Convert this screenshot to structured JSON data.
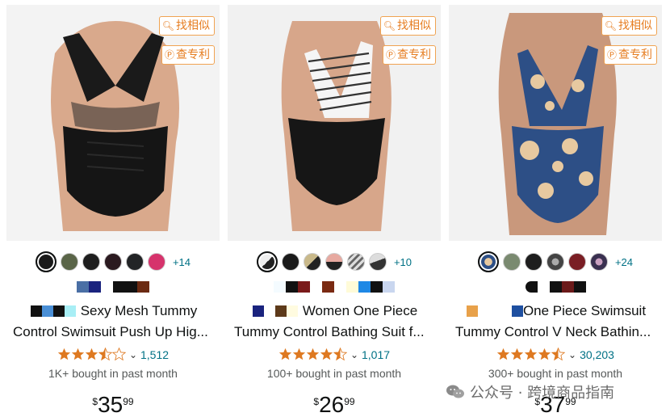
{
  "tools": {
    "find_similar": "找相似",
    "check_patent": "查专利"
  },
  "products": [
    {
      "title_line1": "Sexy Mesh Tummy",
      "title_line2": "Control Swimsuit Push Up Hig...",
      "rating_stars": 3.5,
      "review_count": "1,512",
      "bought": "1K+ bought in past month",
      "price_symbol": "$",
      "price_whole": "35",
      "price_fraction": "99",
      "more_colors": "+14",
      "swatch_colors": [
        "#1a1a1a",
        "#5a6548",
        "#1e1e1e",
        "#2b1a20",
        "#222426",
        "#d6336c"
      ],
      "title_prefix_colors": [
        "#111111",
        "#4a8fd6",
        "#111111",
        "#a8eef5"
      ],
      "block_colors": [
        "#4a6fa5",
        "#1a237e",
        "",
        "#111111",
        "#111111",
        "#6b2a12"
      ]
    },
    {
      "title_line1": "Women One Piece",
      "title_line2": "Tummy Control Bathing Suit f...",
      "rating_stars": 4.5,
      "review_count": "1,017",
      "bought": "100+ bought in past month",
      "price_symbol": "$",
      "price_whole": "26",
      "price_fraction": "99",
      "more_colors": "+10",
      "swatch_colors": [
        "#333333",
        "#1a1a1a",
        "#4a4a3a",
        "#e7a9a0",
        "#9a9a9a",
        "#555555"
      ],
      "title_prefix_colors": [
        "#1a237e",
        "",
        "#5d3a1a",
        "#fffbe0"
      ],
      "block_colors": [
        "#f4fbff",
        "#111111",
        "#7a1a1a",
        "",
        "#7a2a12",
        "",
        "#fffbd8",
        "#1e88e5",
        "#111111",
        "#c9d6ef"
      ]
    },
    {
      "title_line1": "One Piece Swimsuit",
      "title_line2": "Tummy Control V Neck Bathin...",
      "rating_stars": 4.5,
      "review_count": "30,203",
      "bought": "300+ bought in past month",
      "price_symbol": "$",
      "price_whole": "37",
      "price_fraction": "99",
      "more_colors": "+24",
      "swatch_colors": [
        "#6b7fa0",
        "#7a8a70",
        "#1e1e1e",
        "#6a6a6a",
        "#7a1e24",
        "#3a3050"
      ],
      "title_prefix_colors": [
        "#e8a14a",
        "",
        "",
        "",
        "#1e4fa0"
      ],
      "block_colors": [
        "#111111",
        "",
        "#111111",
        "#6b1a1a",
        "#111111"
      ]
    }
  ],
  "watermark": {
    "text": "公众号 · 跨境商品指南"
  }
}
